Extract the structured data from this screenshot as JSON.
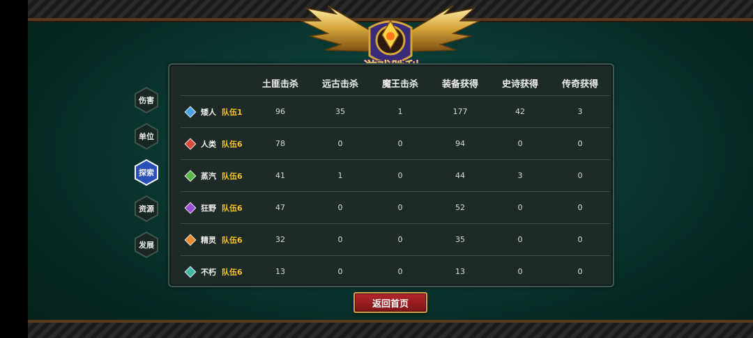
{
  "title_banner": "游戏胜利",
  "side_tabs": [
    {
      "label": "伤害",
      "active": false
    },
    {
      "label": "单位",
      "active": false
    },
    {
      "label": "探索",
      "active": true
    },
    {
      "label": "资源",
      "active": false
    },
    {
      "label": "发展",
      "active": false
    }
  ],
  "table": {
    "headers": [
      "土匪击杀",
      "远古击杀",
      "魔王击杀",
      "装备获得",
      "史诗获得",
      "传奇获得"
    ],
    "rows": [
      {
        "race": "矮人",
        "team": "队伍1",
        "color": "#4aa3e6",
        "values": [
          "96",
          "35",
          "1",
          "177",
          "42",
          "3"
        ]
      },
      {
        "race": "人类",
        "team": "队伍6",
        "color": "#d9483a",
        "values": [
          "78",
          "0",
          "0",
          "94",
          "0",
          "0"
        ]
      },
      {
        "race": "蒸汽",
        "team": "队伍6",
        "color": "#58b84a",
        "values": [
          "41",
          "1",
          "0",
          "44",
          "3",
          "0"
        ]
      },
      {
        "race": "狂野",
        "team": "队伍6",
        "color": "#9a4ed6",
        "values": [
          "47",
          "0",
          "0",
          "52",
          "0",
          "0"
        ]
      },
      {
        "race": "精灵",
        "team": "队伍6",
        "color": "#e8892e",
        "values": [
          "32",
          "0",
          "0",
          "35",
          "0",
          "0"
        ]
      },
      {
        "race": "不朽",
        "team": "队伍6",
        "color": "#3fb7a6",
        "values": [
          "13",
          "0",
          "0",
          "13",
          "0",
          "0"
        ]
      }
    ]
  },
  "back_button": "返回首页",
  "colors": {
    "team_gold": "#f5c518",
    "active_tab": "#2a4fb8",
    "button_red": "#a8202a"
  }
}
